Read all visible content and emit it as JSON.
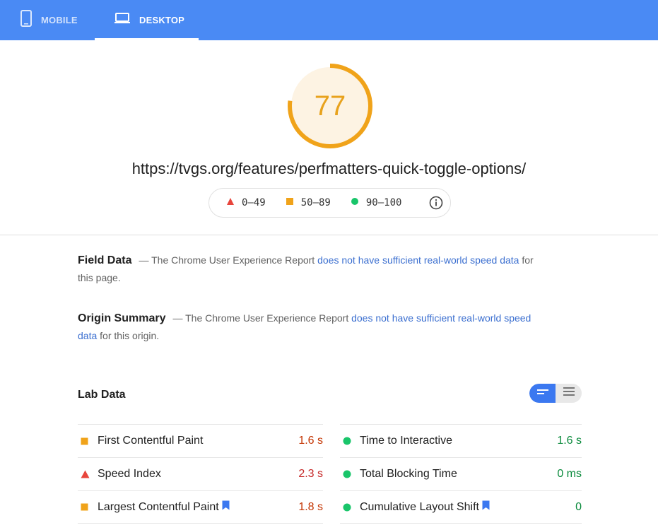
{
  "tabs": [
    {
      "label": "MOBILE",
      "icon": "smartphone-icon",
      "active": false
    },
    {
      "label": "DESKTOP",
      "icon": "laptop-icon",
      "active": true
    }
  ],
  "score": {
    "value": 77,
    "fraction": 0.77,
    "color": "#f0a31a",
    "bg": "#fdf3e3"
  },
  "url": "https://tvgs.org/features/perfmatters-quick-toggle-options/",
  "legend": [
    {
      "range": "0–49",
      "shape": "triangle-icon",
      "color": "#e8453c"
    },
    {
      "range": "50–89",
      "shape": "square-icon",
      "color": "#f0a31a"
    },
    {
      "range": "90–100",
      "shape": "circle-icon",
      "color": "#19c56a"
    }
  ],
  "field_data": {
    "title": "Field Data",
    "prefix": "— The Chrome User Experience Report ",
    "link": "does not have sufficient real-world speed data",
    "suffix": " for this page."
  },
  "origin_summary": {
    "title": "Origin Summary",
    "prefix": "— The Chrome User Experience Report ",
    "link": "does not have sufficient real-world speed data",
    "suffix": " for this origin."
  },
  "lab_data": {
    "title": "Lab Data",
    "metrics_left": [
      {
        "label": "First Contentful Paint",
        "value": "1.6 s",
        "status": "average",
        "bookmark": false
      },
      {
        "label": "Speed Index",
        "value": "2.3 s",
        "status": "fail",
        "bookmark": false
      },
      {
        "label": "Largest Contentful Paint",
        "value": "1.8 s",
        "status": "average",
        "bookmark": true
      }
    ],
    "metrics_right": [
      {
        "label": "Time to Interactive",
        "value": "1.6 s",
        "status": "pass",
        "bookmark": false
      },
      {
        "label": "Total Blocking Time",
        "value": "0 ms",
        "status": "pass",
        "bookmark": false
      },
      {
        "label": "Cumulative Layout Shift",
        "value": "0",
        "status": "pass",
        "bookmark": true
      }
    ]
  },
  "colors": {
    "accent": "#4a8af4",
    "link": "#3b6fd0",
    "bookmark": "#3b78f0"
  }
}
